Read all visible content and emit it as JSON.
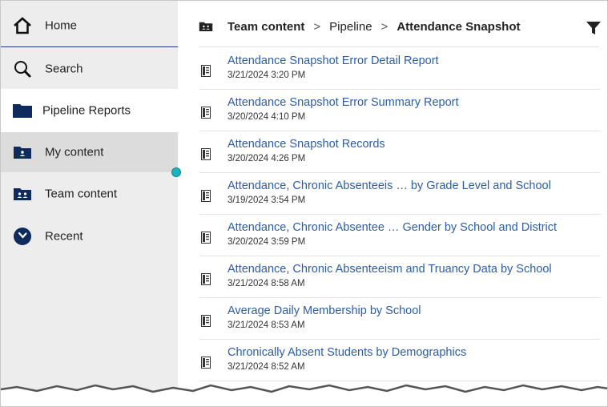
{
  "sidebar": {
    "items": [
      {
        "label": "Home",
        "icon": "home-icon"
      },
      {
        "label": "Search",
        "icon": "search-icon"
      },
      {
        "label": "Pipeline Reports",
        "icon": "folder-icon"
      },
      {
        "label": "My content",
        "icon": "my-content-icon"
      },
      {
        "label": "Team content",
        "icon": "team-content-icon"
      },
      {
        "label": "Recent",
        "icon": "recent-clock-icon"
      }
    ]
  },
  "breadcrumb": {
    "team": "Team content",
    "separator": ">",
    "parent": "Pipeline",
    "current": "Attendance Snapshot"
  },
  "reports": [
    {
      "title": "Attendance Snapshot Error Detail Report",
      "date": "3/21/2024 3:20 PM"
    },
    {
      "title": "Attendance Snapshot Error Summary Report",
      "date": "3/20/2024 4:10 PM"
    },
    {
      "title": "Attendance Snapshot Records",
      "date": "3/20/2024 4:26 PM"
    },
    {
      "title": "Attendance, Chronic Absenteeis … by Grade Level and School",
      "date": "3/19/2024 3:54 PM"
    },
    {
      "title": "Attendance, Chronic Absentee … Gender by School and District",
      "date": "3/20/2024 3:59 PM"
    },
    {
      "title": "Attendance, Chronic Absenteeism and Truancy Data by School",
      "date": "3/21/2024 8:58 AM"
    },
    {
      "title": "Average Daily Membership by School",
      "date": "3/21/2024 8:53 AM"
    },
    {
      "title": "Chronically Absent Students by Demographics",
      "date": "3/21/2024 8:52 AM"
    }
  ],
  "colors": {
    "link": "#2c5ea8",
    "sidebar_bg": "#ededed",
    "selected_bg": "#dcdcdc",
    "accent": "#1bb3c2",
    "navy": "#0f2a5c"
  }
}
